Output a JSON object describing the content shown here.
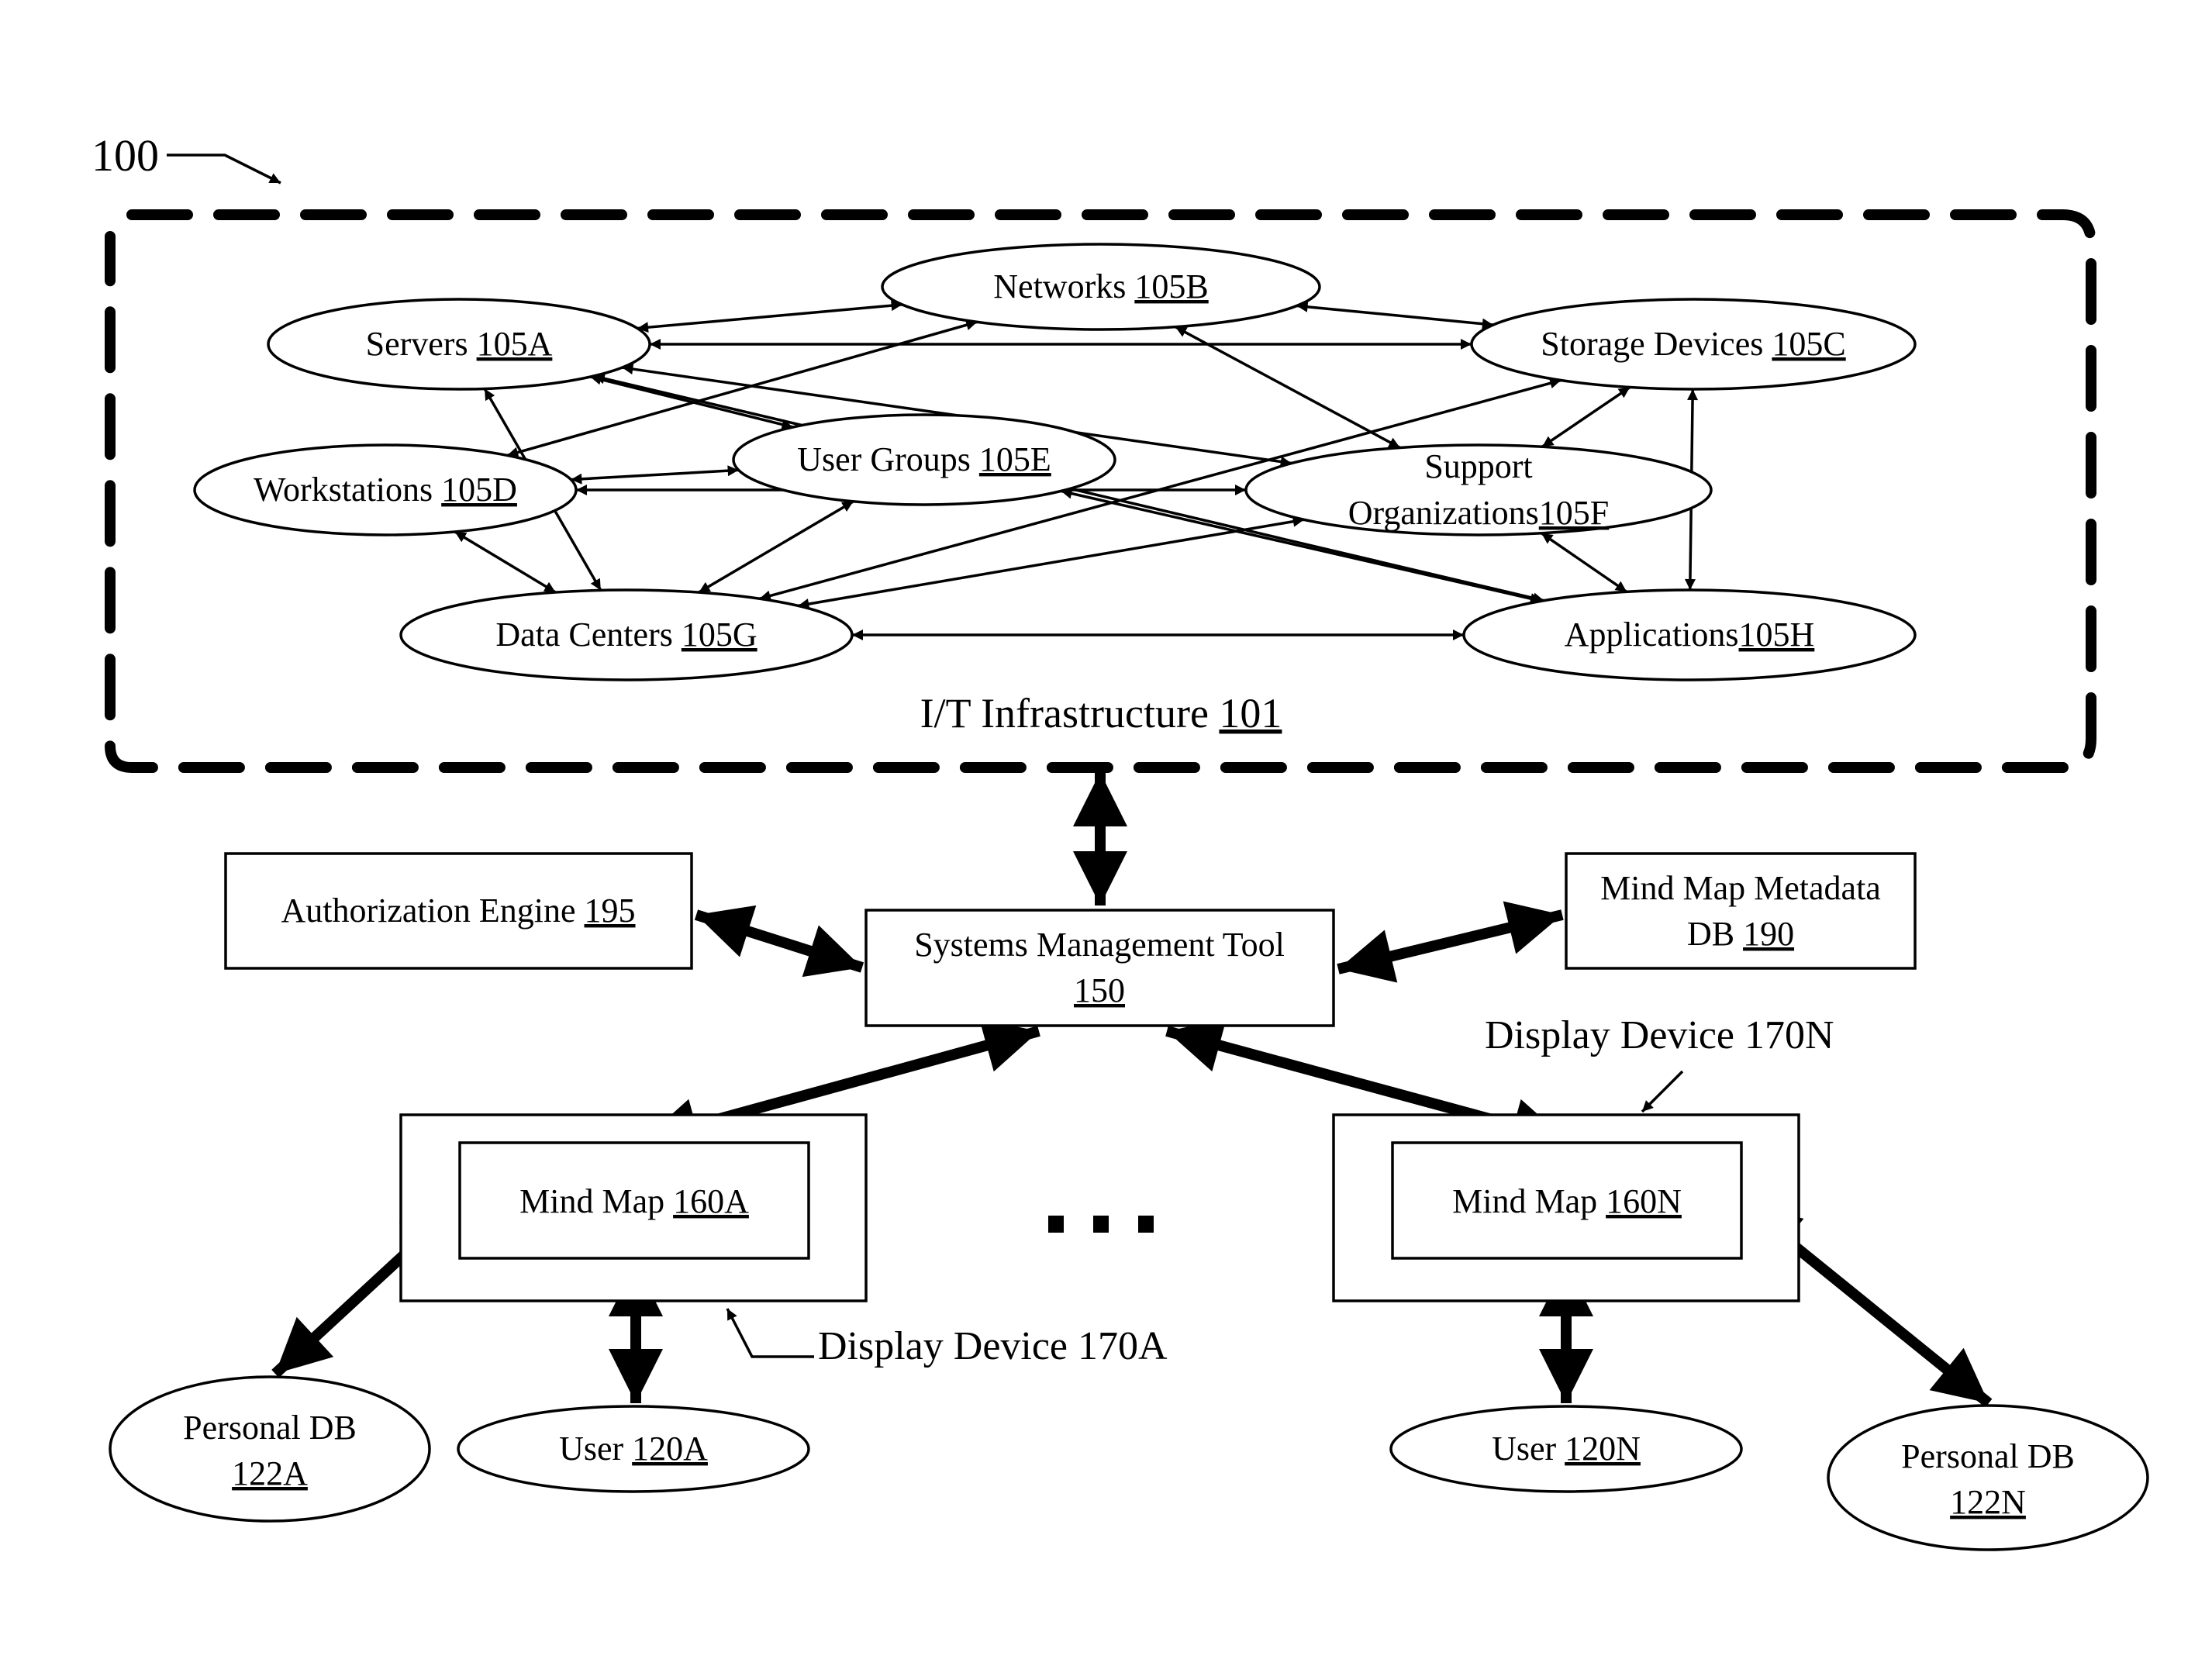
{
  "figure": {
    "reference_label": "100",
    "infrastructure": {
      "label_text": "I/T Infrastructure ",
      "label_ref": "101"
    },
    "infrastructure_nodes": [
      {
        "id": "A",
        "text": "Servers ",
        "ref": "105A"
      },
      {
        "id": "B",
        "text": "Networks ",
        "ref": "105B"
      },
      {
        "id": "C",
        "text": "Storage Devices ",
        "ref": "105C"
      },
      {
        "id": "D",
        "text": "Workstations ",
        "ref": "105D"
      },
      {
        "id": "E",
        "text": "User Groups ",
        "ref": "105E"
      },
      {
        "id": "F",
        "text_line1": "Support",
        "text_line2": "Organizations",
        "ref": "105F"
      },
      {
        "id": "G",
        "text": "Data Centers ",
        "ref": "105G"
      },
      {
        "id": "H",
        "text": "Applications",
        "ref": "105H"
      }
    ],
    "infrastructure_links": [
      [
        "A",
        "B"
      ],
      [
        "A",
        "C"
      ],
      [
        "A",
        "E"
      ],
      [
        "A",
        "F"
      ],
      [
        "A",
        "G"
      ],
      [
        "A",
        "H"
      ],
      [
        "B",
        "D"
      ],
      [
        "B",
        "C"
      ],
      [
        "B",
        "F"
      ],
      [
        "C",
        "F"
      ],
      [
        "C",
        "G"
      ],
      [
        "C",
        "H"
      ],
      [
        "D",
        "E"
      ],
      [
        "D",
        "F"
      ],
      [
        "D",
        "G"
      ],
      [
        "E",
        "G"
      ],
      [
        "E",
        "H"
      ],
      [
        "F",
        "G"
      ],
      [
        "F",
        "H"
      ],
      [
        "G",
        "H"
      ]
    ],
    "authorization_engine": {
      "text": "Authorization Engine ",
      "ref": "195"
    },
    "systems_management_tool": {
      "text": "Systems Management Tool",
      "ref": "150"
    },
    "mind_map_metadata_db": {
      "text_line1": "Mind Map Metadata",
      "text_line2": "DB ",
      "ref": "190"
    },
    "display_devices": [
      {
        "label": "Display Device  170A",
        "mind_map_text": "Mind Map ",
        "mind_map_ref": "160A",
        "user_text": "User ",
        "user_ref": "120A",
        "personal_db_text": "Personal DB",
        "personal_db_ref": "122A"
      },
      {
        "label": "Display Device  170N",
        "mind_map_text": "Mind Map ",
        "mind_map_ref": "160N",
        "user_text": "User ",
        "user_ref": "120N",
        "personal_db_text": "Personal DB",
        "personal_db_ref": "122N"
      }
    ],
    "ellipsis": "..."
  }
}
